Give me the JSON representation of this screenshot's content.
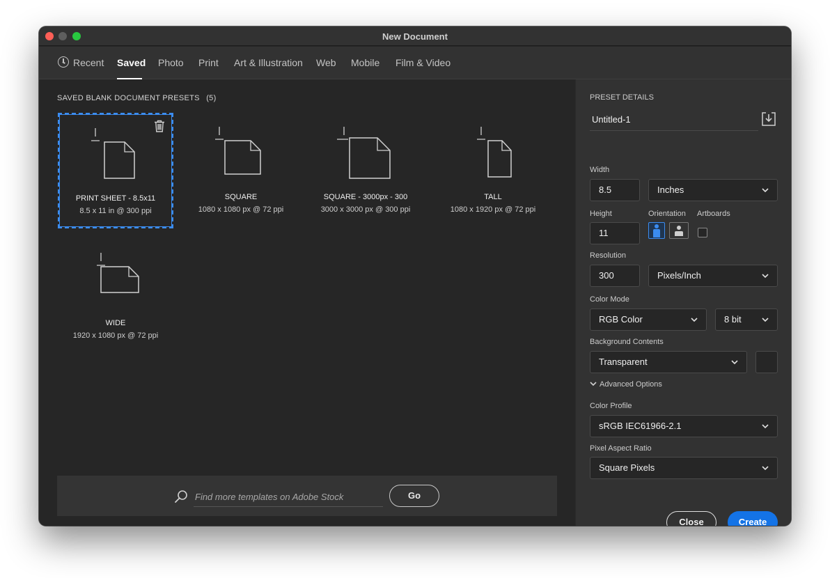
{
  "window": {
    "title": "New Document"
  },
  "tabs": [
    {
      "label": "Recent"
    },
    {
      "label": "Saved",
      "active": true
    },
    {
      "label": "Photo"
    },
    {
      "label": "Print"
    },
    {
      "label": "Art & Illustration"
    },
    {
      "label": "Web"
    },
    {
      "label": "Mobile"
    },
    {
      "label": "Film & Video"
    }
  ],
  "presets": {
    "heading": "SAVED BLANK DOCUMENT PRESETS",
    "count": "(5)",
    "items": [
      {
        "name": "PRINT SHEET - 8.5x11",
        "detail": "8.5 x 11 in @ 300 ppi",
        "selected": true
      },
      {
        "name": "SQUARE",
        "detail": "1080 x 1080 px @ 72 ppi"
      },
      {
        "name": "SQUARE - 3000px - 300",
        "detail": "3000 x 3000 px @ 300 ppi"
      },
      {
        "name": "TALL",
        "detail": "1080 x 1920 px @ 72 ppi"
      },
      {
        "name": "WIDE",
        "detail": "1920 x 1080 px @ 72 ppi"
      }
    ]
  },
  "search": {
    "placeholder": "Find more templates on Adobe Stock",
    "go_label": "Go"
  },
  "details": {
    "heading": "PRESET DETAILS",
    "name": "Untitled-1",
    "width_label": "Width",
    "width": "8.5",
    "width_unit": "Inches",
    "height_label": "Height",
    "height": "11",
    "orientation_label": "Orientation",
    "artboards_label": "Artboards",
    "resolution_label": "Resolution",
    "resolution": "300",
    "resolution_unit": "Pixels/Inch",
    "color_mode_label": "Color Mode",
    "color_mode": "RGB Color",
    "bit_depth": "8 bit",
    "background_label": "Background Contents",
    "background": "Transparent",
    "advanced_label": "Advanced Options",
    "color_profile_label": "Color Profile",
    "color_profile": "sRGB IEC61966-2.1",
    "pixel_aspect_label": "Pixel Aspect Ratio",
    "pixel_aspect": "Square Pixels"
  },
  "buttons": {
    "close": "Close",
    "create": "Create"
  },
  "colors": {
    "accent": "#1473e6",
    "selection": "#3b8cf0",
    "panel": "#323232",
    "background": "#262626"
  }
}
